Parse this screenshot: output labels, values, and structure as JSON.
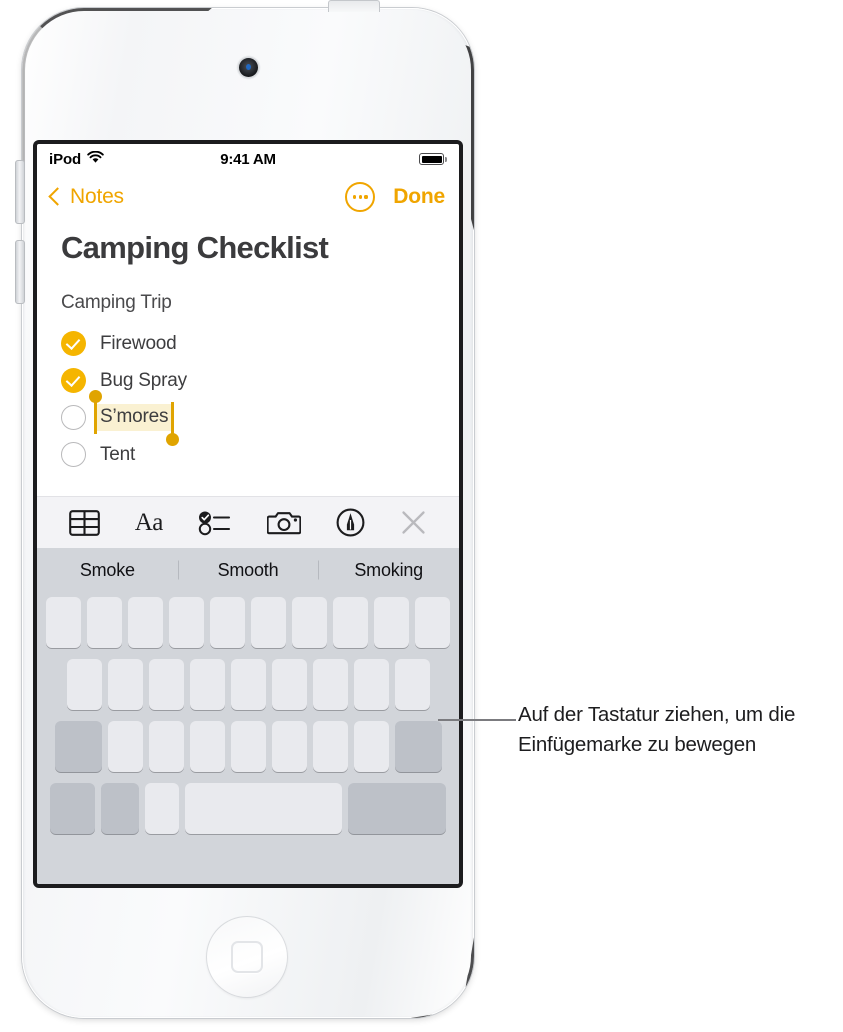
{
  "device": {
    "name": "iPod touch",
    "camera_icon": "front-camera",
    "home_button_icon": "home-square-icon"
  },
  "status_bar": {
    "carrier": "iPod",
    "wifi_icon": "wifi-icon",
    "time": "9:41 AM",
    "battery_icon": "battery-full-icon"
  },
  "nav_bar": {
    "back_label": "Notes",
    "back_icon": "chevron-left-icon",
    "more_icon": "more-ellipsis-icon",
    "done_label": "Done"
  },
  "note": {
    "title": "Camping Checklist",
    "section_label": "Camping Trip",
    "items": [
      {
        "label": "Firewood",
        "checked": true,
        "selected": false
      },
      {
        "label": "Bug Spray",
        "checked": true,
        "selected": false
      },
      {
        "label": "S’mores",
        "checked": false,
        "selected": true
      },
      {
        "label": "Tent",
        "checked": false,
        "selected": false
      }
    ],
    "selection_handle_color": "#E0A400",
    "selection_highlight_color": "#FAF1D2",
    "checkbox_color": "#F5B500"
  },
  "format_toolbar": {
    "items": [
      {
        "icon": "table-icon",
        "label": "Table"
      },
      {
        "icon": "text-format-aa-icon",
        "label": "Aa"
      },
      {
        "icon": "checklist-icon",
        "label": "Checklist"
      },
      {
        "icon": "camera-icon",
        "label": "Camera"
      },
      {
        "icon": "markup-pen-icon",
        "label": "Markup"
      },
      {
        "icon": "close-x-icon",
        "label": "Close"
      }
    ]
  },
  "predictive_bar": {
    "suggestions": [
      "Smoke",
      "Smooth",
      "Smoking"
    ]
  },
  "keyboard": {
    "state": "trackpad-mode-blank-keys",
    "rows": [
      {
        "keys": [
          {
            "type": "letter"
          },
          {
            "type": "letter"
          },
          {
            "type": "letter"
          },
          {
            "type": "letter"
          },
          {
            "type": "letter"
          },
          {
            "type": "letter"
          },
          {
            "type": "letter"
          },
          {
            "type": "letter"
          },
          {
            "type": "letter"
          },
          {
            "type": "letter"
          }
        ]
      },
      {
        "keys": [
          {
            "type": "letter"
          },
          {
            "type": "letter"
          },
          {
            "type": "letter"
          },
          {
            "type": "letter"
          },
          {
            "type": "letter"
          },
          {
            "type": "letter"
          },
          {
            "type": "letter"
          },
          {
            "type": "letter"
          },
          {
            "type": "letter"
          }
        ]
      },
      {
        "keys": [
          {
            "type": "shift"
          },
          {
            "type": "letter"
          },
          {
            "type": "letter"
          },
          {
            "type": "letter"
          },
          {
            "type": "letter"
          },
          {
            "type": "letter"
          },
          {
            "type": "letter"
          },
          {
            "type": "letter"
          },
          {
            "type": "delete"
          }
        ]
      },
      {
        "keys": [
          {
            "type": "num"
          },
          {
            "type": "globe"
          },
          {
            "type": "mic"
          },
          {
            "type": "space"
          },
          {
            "type": "return"
          }
        ]
      }
    ]
  },
  "callout": {
    "text": "Auf der Tastatur ziehen, um die Einfügemarke zu bewegen"
  }
}
